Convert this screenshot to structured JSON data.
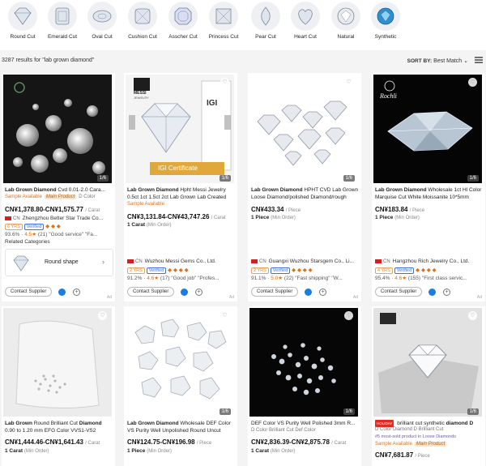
{
  "cut_filters": [
    {
      "label": "Round Cut",
      "icon": "round-diamond-icon"
    },
    {
      "label": "Emerald Cut",
      "icon": "emerald-cut-icon"
    },
    {
      "label": "Oval Cut",
      "icon": "oval-cut-icon"
    },
    {
      "label": "Cushion Cut",
      "icon": "cushion-cut-icon"
    },
    {
      "label": "Asscher Cut",
      "icon": "asscher-cut-icon"
    },
    {
      "label": "Princess Cut",
      "icon": "princess-cut-icon"
    },
    {
      "label": "Pear Cut",
      "icon": "pear-cut-icon"
    },
    {
      "label": "Heart Cut",
      "icon": "heart-cut-icon"
    },
    {
      "label": "Natural",
      "icon": "natural-diamond-icon"
    },
    {
      "label": "Synthetic",
      "icon": "synthetic-diamond-icon"
    }
  ],
  "results": {
    "count_text": "3287 results for \"lab grown diamond\"",
    "sort_label": "SORT BY:",
    "sort_value": "Best Match"
  },
  "colors": {
    "accent": "#e0701a",
    "verified": "#3b73d6",
    "rating": "#e0701a",
    "chat": "#1b7de0"
  },
  "products": [
    {
      "title_bold": "Lab Grown Diamond",
      "title_rest": " Cvd 0.01-2.0 Cara...",
      "sample": "Sample Available",
      "main_product": "Main Product",
      "d_color": "D Color",
      "price": "CN¥1,378.80-CN¥1,575.77",
      "price_unit": "/ Carat",
      "supplier": "Zhengzhou Better Star Trade Co...",
      "country": "CN",
      "years": "6 YRS",
      "verified": "Verified",
      "rating_pct": "93.6%",
      "rating": "4.5",
      "reviews": "(21) \"Good service\" \"Fa...",
      "pager": "1/6"
    },
    {
      "title_bold": "Lab Grown Diamond",
      "title_rest": " Hpht Messi Jewelry 0.5ct 1ct 1.5ct 2ct Lab Grown Lab Created",
      "sample": "Sample Available",
      "price": "CN¥3,131.84-CN¥43,747.26",
      "price_unit": "/ Carat",
      "moq": "1 Carat",
      "moq_note": "(Min Order)",
      "supplier": "Wuzhou Messi Gems Co., Ltd.",
      "country": "CN",
      "years": "2 YRS",
      "verified": "Verified",
      "rating_pct": "91.2%",
      "rating": "4.6",
      "reviews": "(17) \"Good job\" \"Profes...",
      "brand_top": "MESSI",
      "brand_sub": "JEWELRY",
      "cert_badge": "IGI",
      "cert_label": "IGI Certificate",
      "pager": "1/6"
    },
    {
      "title_bold": "Lab Grown Diamond",
      "title_rest": " HPHT CVD Lab Grown Loose Diamond/polished Diamond/rough",
      "price": "CN¥433.34",
      "price_unit": "/ Piece",
      "moq": "1 Piece",
      "moq_note": "(Min Order)",
      "supplier": "Guangxi Wuzhou Starsgem Co., Li...",
      "country": "CN",
      "years": "2 YRS",
      "verified": "Verified",
      "rating_pct": "91.1%",
      "rating": "5.0",
      "reviews": "(22) \"Fast shipping\" \"W...",
      "pager": "1/6"
    },
    {
      "title_bold": "Lab Grown Diamond",
      "title_rest": " Wholesale 1ct Hl Color Marquise Cut White Moissanite 10*5mm",
      "price": "CN¥183.84",
      "price_unit": "/ Piece",
      "moq": "1 Piece",
      "moq_note": "(Min Order)",
      "supplier": "Hangzhou Rich Jewelry Co., Ltd.",
      "country": "CN",
      "years": "4 YRS",
      "verified": "Verified",
      "rating_pct": "95.4%",
      "rating": "4.6",
      "reviews": "(155) \"First class servic...",
      "brand": "Rochli",
      "pager": "1/6"
    },
    {
      "title_bold": "Lab Grown",
      "title_rest": " Round Brilliant Cut ",
      "title_bold2": "Diamond",
      "title_rest2": " 0.90 to 1.20 mm EFG Color VVS1-VS2",
      "price": "CN¥1,444.46-CN¥1,641.43",
      "price_unit": "/ Carat",
      "moq": "1 Carat",
      "moq_note": "(Min Order)",
      "pager": ""
    },
    {
      "title_bold": "Lab Grown Diamond",
      "title_rest": " Wholesale DEF Color VS Purity Well Unpolished Round Uncut",
      "price": "CN¥124.75-CN¥196.98",
      "price_unit": "/ Piece",
      "moq": "1 Piece",
      "moq_note": "(Min Order)",
      "pager": "1/6"
    },
    {
      "title_bold": "",
      "title_rest": "DEF Color VS Purity Well Polished 3mm R...",
      "line2": "D Color  Brilliant Cut  Def Color",
      "price": "CN¥2,836.39-CN¥2,875.78",
      "price_unit": "/ Carat",
      "moq": "1 Carat",
      "moq_note": "(Min Order)",
      "pager": "1/6"
    },
    {
      "hot": "HOLIDAY",
      "title_rest": " brilliant cut synthetic ",
      "title_bold": "diamond D",
      "line2": "D Color  Diamond D  Brilliant Cut",
      "most_sold": "#5 most-sold product in Loose Diamonds",
      "sample": "Sample Available",
      "main_product": "Main Product",
      "price": "CN¥7,681.87",
      "price_unit": "/ Piece",
      "pager": "1/6"
    }
  ],
  "related": {
    "heading": "Related Categories",
    "item": "Round shape"
  },
  "contact_label": "Contact Supplier",
  "ad_label": "Ad"
}
